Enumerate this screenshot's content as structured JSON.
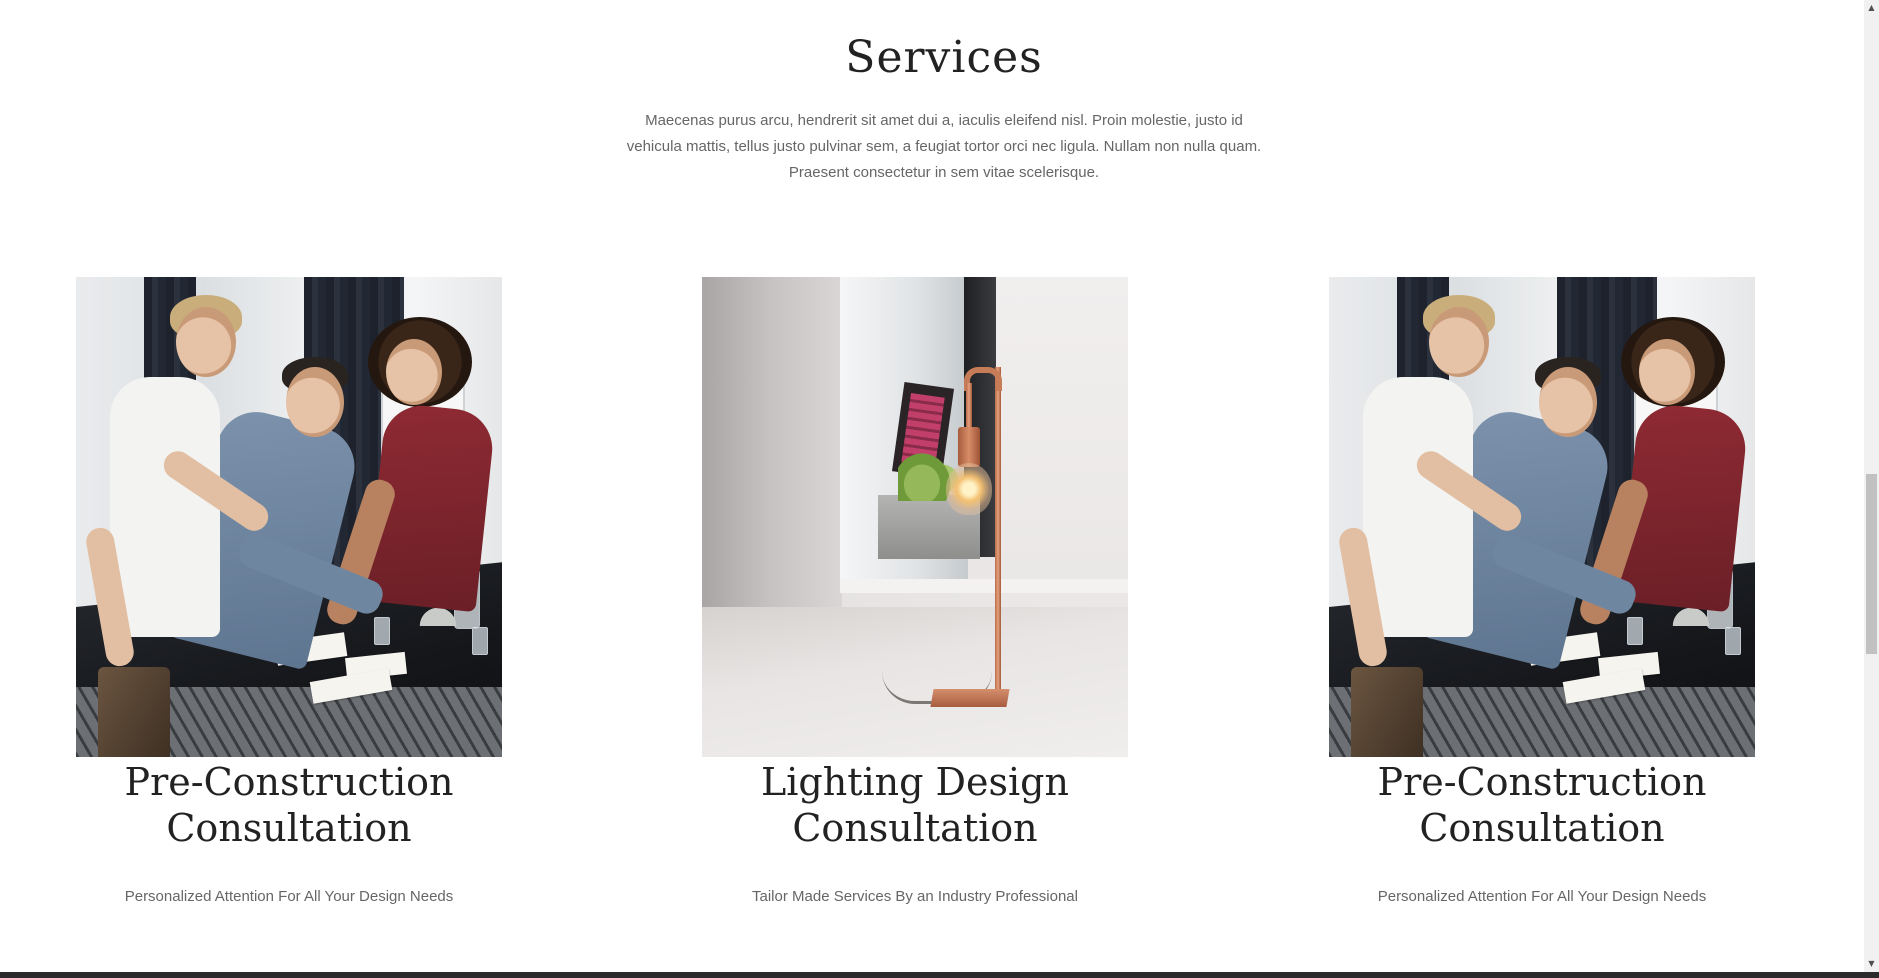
{
  "services": {
    "title": "Services",
    "description": "Maecenas purus arcu, hendrerit sit amet dui a, iaculis eleifend nisl. Proin molestie, justo id vehicula mattis, tellus justo pulvinar sem, a feugiat tortor orci nec ligula. Nullam non nulla quam. Praesent consectetur in sem vitae scelerisque.",
    "cards": [
      {
        "title": "Pre-Construction Consultation",
        "subtitle": "Personalized Attention For All Your Design Needs",
        "image": "team-meeting-photo"
      },
      {
        "title": "Lighting Design Consultation",
        "subtitle": "Tailor Made Services By an Industry Professional",
        "image": "copper-desk-lamp-photo"
      },
      {
        "title": "Pre-Construction Consultation",
        "subtitle": "Personalized Attention For All Your Design Needs",
        "image": "team-meeting-photo"
      }
    ]
  },
  "scrollbar": {
    "up_icon": "triangle-up-icon",
    "down_icon": "triangle-down-icon"
  }
}
